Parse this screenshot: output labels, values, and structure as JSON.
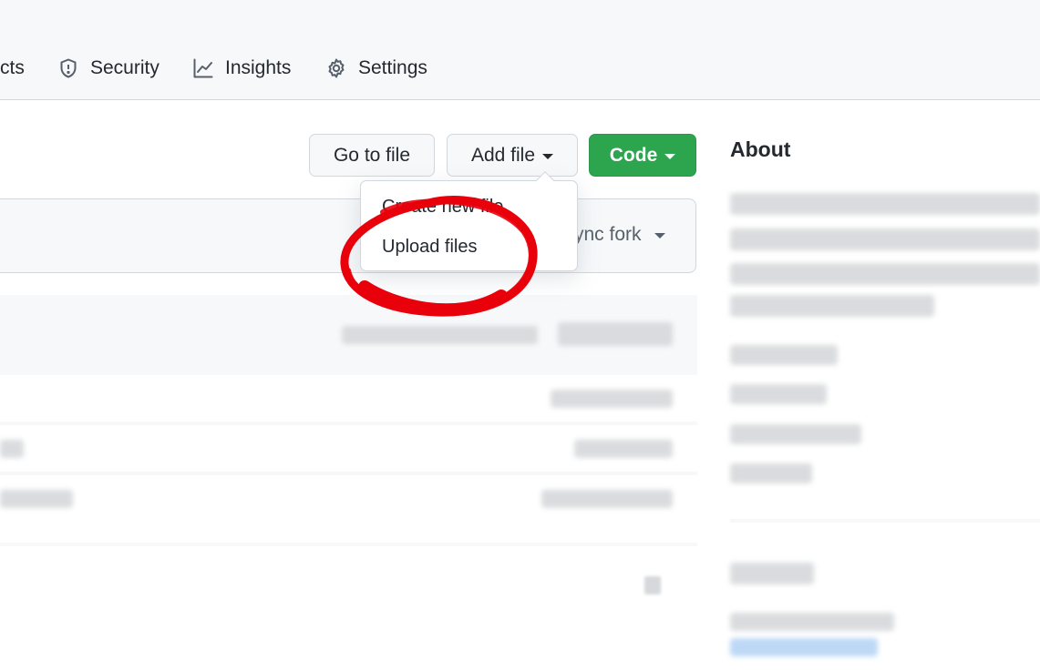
{
  "nav": {
    "projects_partial": "cts",
    "security": "Security",
    "insights": "Insights",
    "settings": "Settings"
  },
  "toolbar": {
    "go_to_file": "Go to file",
    "add_file": "Add file",
    "code": "Code"
  },
  "branch": {
    "sync_fork_partial": "ync fork"
  },
  "dropdown": {
    "items": [
      "Create new file",
      "Upload files"
    ]
  },
  "about": {
    "title": "About"
  },
  "colors": {
    "accent_green": "#2da44e",
    "annotation_red": "#e8000b",
    "border": "#d0d7de"
  }
}
